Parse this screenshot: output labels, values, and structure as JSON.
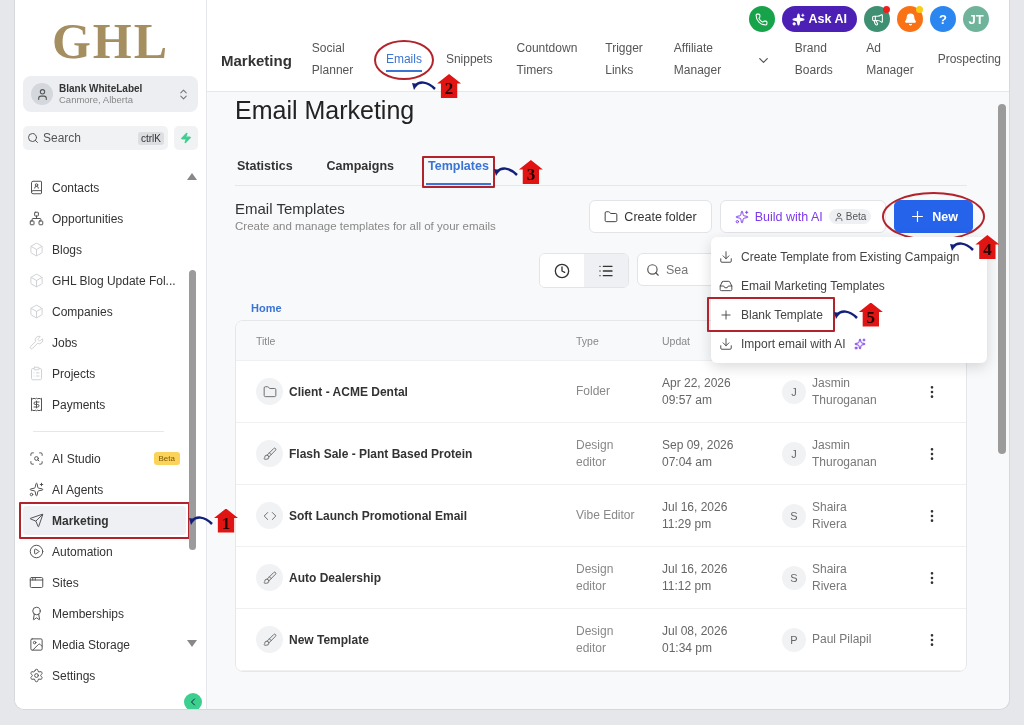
{
  "sidebar": {
    "logo": "GHL",
    "account": {
      "name": "Blank WhiteLabel",
      "location": "Canmore, Alberta"
    },
    "search": {
      "placeholder": "Search",
      "shortcut": "ctrlK"
    },
    "groups": [
      {
        "items": [
          {
            "label": "Contacts",
            "faded": false,
            "selected": false
          },
          {
            "label": "Opportunities",
            "faded": false,
            "selected": false
          },
          {
            "label": "Blogs",
            "faded": true,
            "selected": false
          },
          {
            "label": "GHL Blog Update Fol...",
            "faded": true,
            "selected": false
          },
          {
            "label": "Companies",
            "faded": true,
            "selected": false
          },
          {
            "label": "Jobs",
            "faded": true,
            "selected": false
          },
          {
            "label": "Projects",
            "faded": true,
            "selected": false
          },
          {
            "label": "Payments",
            "faded": false,
            "selected": false
          }
        ]
      },
      {
        "items": [
          {
            "label": "AI Studio",
            "faded": false,
            "selected": false,
            "badge": "Beta"
          },
          {
            "label": "AI Agents",
            "faded": false,
            "selected": false
          },
          {
            "label": "Marketing",
            "faded": false,
            "selected": true,
            "callout": "1"
          },
          {
            "label": "Automation",
            "faded": false,
            "selected": false
          },
          {
            "label": "Sites",
            "faded": false,
            "selected": false
          },
          {
            "label": "Memberships",
            "faded": false,
            "selected": false
          },
          {
            "label": "Media Storage",
            "faded": false,
            "selected": false
          },
          {
            "label": "Settings",
            "faded": false,
            "selected": false
          }
        ]
      }
    ]
  },
  "header": {
    "actions": [
      {
        "kind": "phone"
      },
      {
        "kind": "ask_ai",
        "label": "Ask AI"
      },
      {
        "kind": "megaphone",
        "dot": true
      },
      {
        "kind": "bell",
        "dot": true
      },
      {
        "kind": "help",
        "label": "?"
      },
      {
        "kind": "avatar",
        "label": "JT"
      }
    ],
    "section": "Marketing",
    "nav": [
      {
        "kind": "link",
        "label": "Social Planner",
        "selected": false
      },
      {
        "kind": "link",
        "label": "Emails",
        "selected": true,
        "callout": "2"
      },
      {
        "kind": "link",
        "label": "Snippets",
        "selected": false
      },
      {
        "kind": "link",
        "label": "Countdown Timers",
        "selected": false
      },
      {
        "kind": "link",
        "label": "Trigger Links",
        "selected": false
      },
      {
        "kind": "link",
        "label": "Affiliate Manager",
        "selected": false
      },
      {
        "kind": "dropdown"
      },
      {
        "kind": "link",
        "label": "Brand Boards",
        "selected": false
      },
      {
        "kind": "link",
        "label": "Ad Manager",
        "selected": false
      },
      {
        "kind": "link",
        "label": "Prospecting",
        "selected": false
      }
    ]
  },
  "page": {
    "title": "Email Marketing",
    "tabs": [
      {
        "label": "Statistics",
        "selected": false
      },
      {
        "label": "Campaigns",
        "selected": false
      },
      {
        "label": "Templates",
        "selected": true,
        "callout": "3"
      }
    ],
    "section": {
      "title": "Email Templates",
      "subtitle": "Create and manage templates for all of your emails"
    },
    "buttons": [
      {
        "kind": "folder",
        "label": "Create folder"
      },
      {
        "kind": "ai",
        "label": "Build with AI",
        "badge": "Beta"
      },
      {
        "kind": "new",
        "label": "New",
        "callout": "4"
      }
    ],
    "menu": [
      {
        "kind": "download",
        "label": "Create Template from Existing Campaign",
        "sparkle": false
      },
      {
        "kind": "inbox",
        "label": "Email Marketing Templates",
        "sparkle": false
      },
      {
        "kind": "plus",
        "label": "Blank Template",
        "sparkle": false,
        "callout": "5"
      },
      {
        "kind": "download",
        "label": "Import email with AI",
        "sparkle": true
      }
    ],
    "views": [
      {
        "kind": "recent",
        "selected": false
      },
      {
        "kind": "list",
        "selected": true
      }
    ],
    "search": {
      "placeholder": "Sea"
    },
    "breadcrumb": "Home",
    "table": {
      "columns": [
        "Title",
        "Type",
        "Updat"
      ],
      "rows": [
        {
          "kind": "folder",
          "title": "Client - ACME Dental",
          "type": "Folder",
          "updated": [
            "Apr 22, 2026",
            "09:57 am"
          ],
          "initial": "J",
          "author": [
            "Jasmin",
            "Thuroganan"
          ]
        },
        {
          "kind": "design",
          "title": "Flash Sale - Plant Based Protein",
          "type": "Design editor",
          "updated": [
            "Sep 09, 2026",
            "07:04 am"
          ],
          "initial": "J",
          "author": [
            "Jasmin",
            "Thuroganan"
          ]
        },
        {
          "kind": "code",
          "title": "Soft Launch Promotional Email",
          "type": "Vibe Editor",
          "updated": [
            "Jul 16, 2026",
            "11:29 pm"
          ],
          "initial": "S",
          "author": [
            "Shaira",
            "Rivera"
          ]
        },
        {
          "kind": "design",
          "title": "Auto Dealership",
          "type": "Design editor",
          "updated": [
            "Jul 16, 2026",
            "11:12 pm"
          ],
          "initial": "S",
          "author": [
            "Shaira",
            "Rivera"
          ]
        },
        {
          "kind": "design",
          "title": "New Template",
          "type": "Design editor",
          "updated": [
            "Jul 08, 2026",
            "01:34 pm"
          ],
          "initial": "P",
          "author": [
            "Paul Pilapil"
          ]
        }
      ]
    }
  }
}
